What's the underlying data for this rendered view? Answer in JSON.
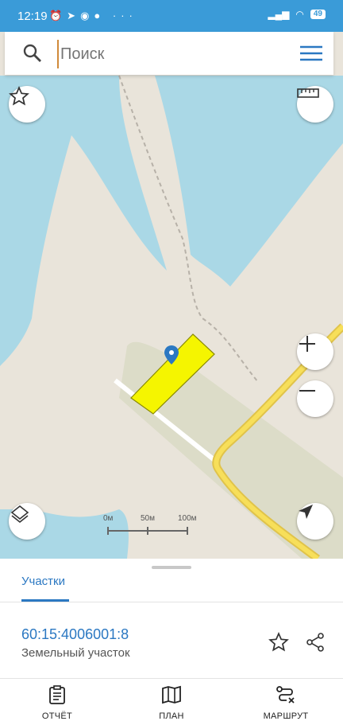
{
  "status_bar": {
    "time": "12:19",
    "battery": "49"
  },
  "search": {
    "placeholder": "Поиск"
  },
  "map": {
    "scale_labels": [
      "0м",
      "50м",
      "100м"
    ],
    "colors": {
      "water": "#aad8e6",
      "land": "#e9e4da",
      "parcel_fill": "#f5f500",
      "road": "#f0d24a",
      "accent": "#2b78c2"
    }
  },
  "sheet": {
    "tab_label": "Участки",
    "parcel_id": "60:15:4006001:8",
    "parcel_type": "Земельный участок"
  },
  "bottom_nav": {
    "report": "ОТЧЁТ",
    "plan": "ПЛАН",
    "route": "МАРШРУТ"
  }
}
